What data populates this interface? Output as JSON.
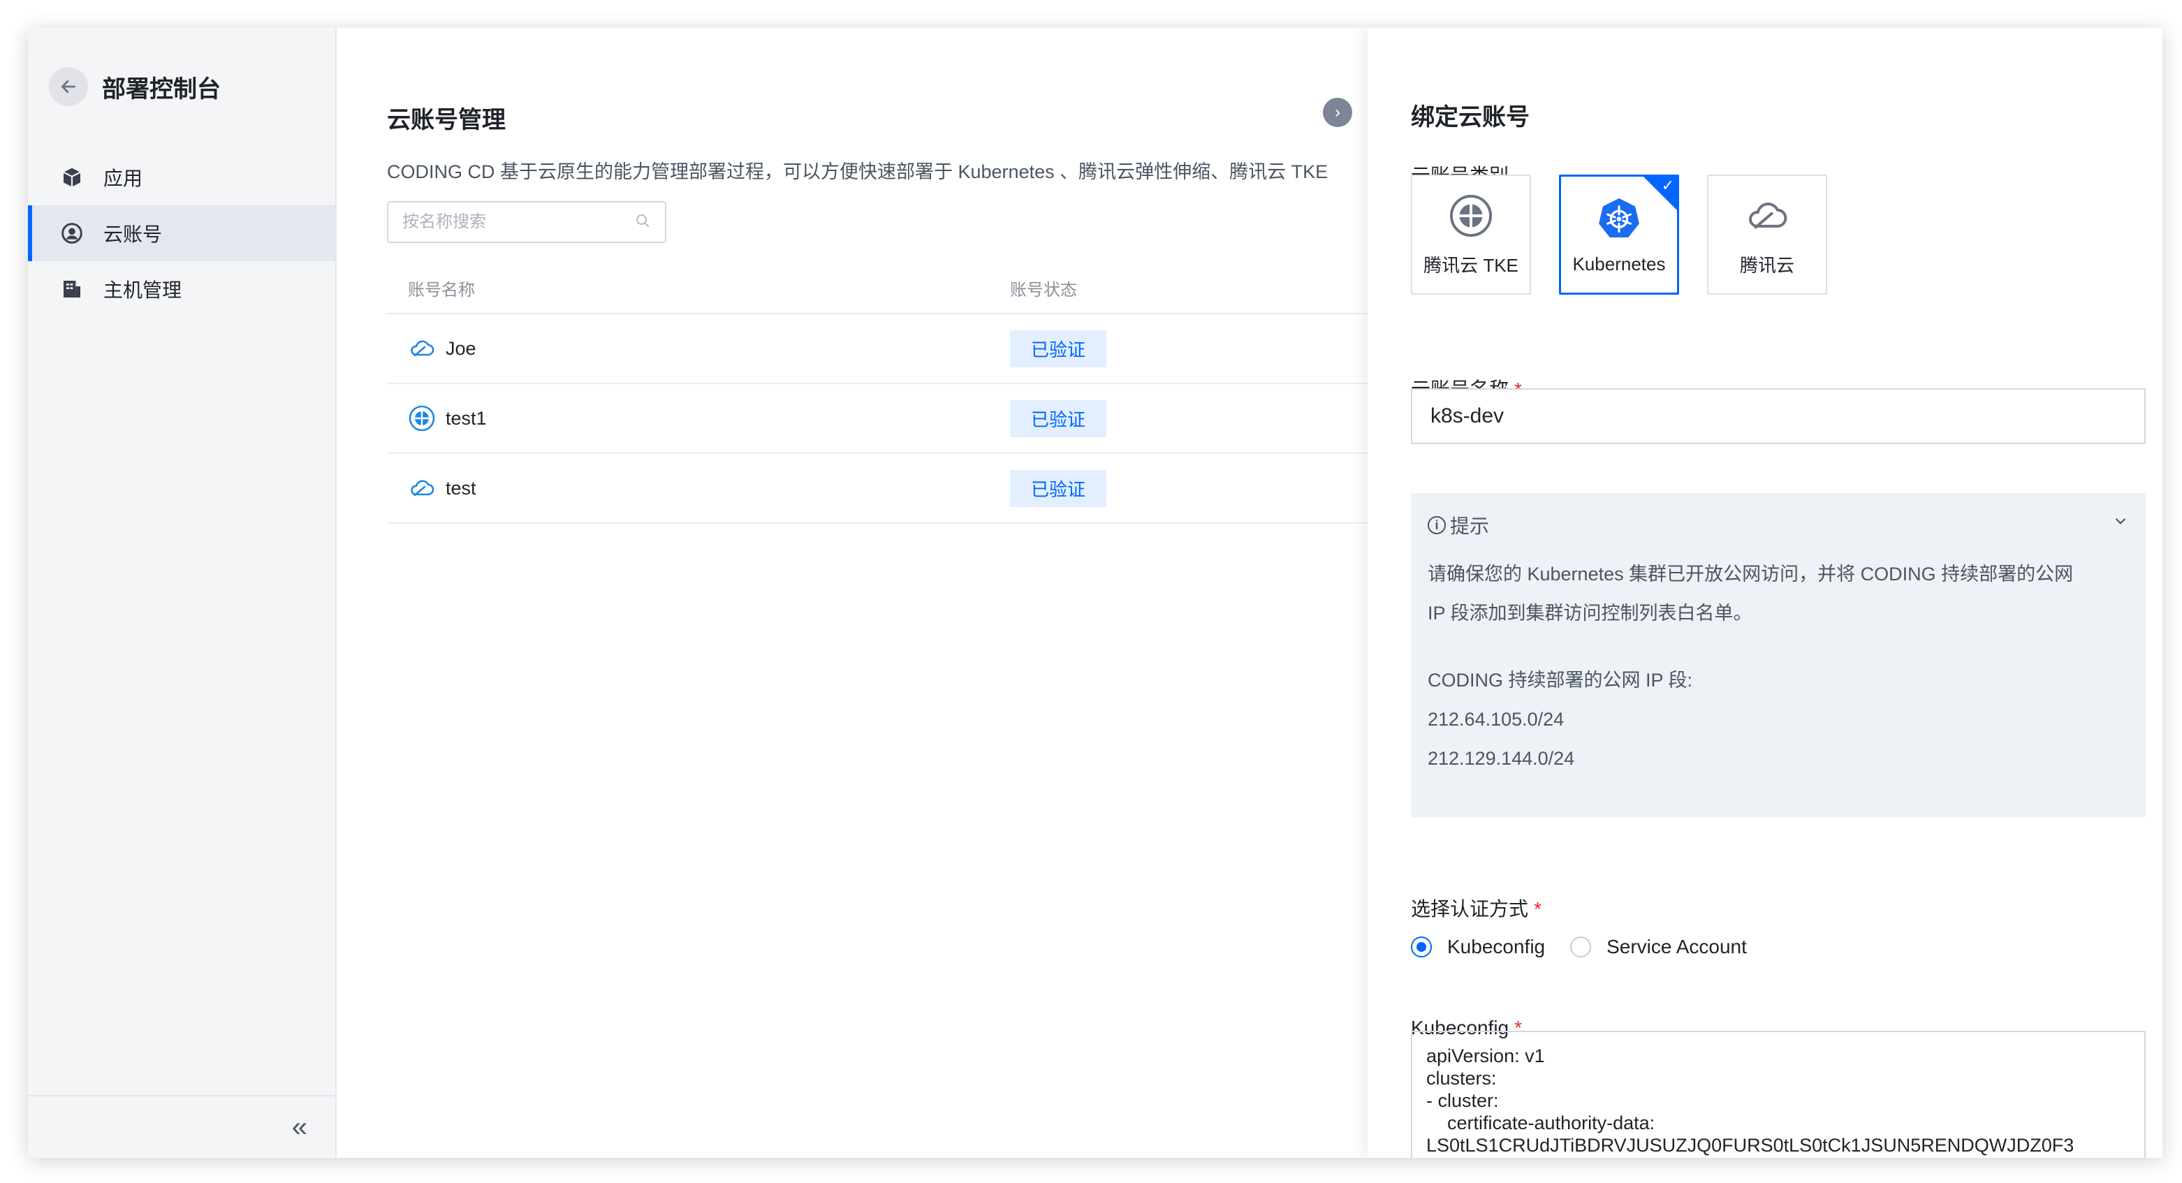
{
  "sidebar": {
    "title": "部署控制台",
    "items": [
      {
        "label": "应用",
        "icon": "cube-icon"
      },
      {
        "label": "云账号",
        "icon": "user-circle-icon"
      },
      {
        "label": "主机管理",
        "icon": "server-icon"
      }
    ],
    "active_item": "云账号",
    "collapse_icon": "double-chevron-left-icon"
  },
  "main": {
    "title": "云账号管理",
    "description": "CODING CD 基于云原生的能力管理部署过程，可以方便快速部署于 Kubernetes 、腾讯云弹性伸缩、腾讯云 TKE",
    "search": {
      "placeholder": "按名称搜索",
      "value": ""
    },
    "table": {
      "columns": [
        "账号名称",
        "账号状态"
      ],
      "rows": [
        {
          "name": "Joe",
          "icon": "cloud-icon",
          "status": "已验证"
        },
        {
          "name": "test1",
          "icon": "tke-icon",
          "status": "已验证"
        },
        {
          "name": "test",
          "icon": "cloud-icon",
          "status": "已验证"
        }
      ]
    }
  },
  "drawer": {
    "title": "绑定云账号",
    "type_label": "云账号类别",
    "types": [
      {
        "label": "腾讯云 TKE",
        "icon": "tke-icon",
        "selected": false
      },
      {
        "label": "Kubernetes",
        "icon": "kubernetes-icon",
        "selected": true
      },
      {
        "label": "腾讯云",
        "icon": "cloud-icon",
        "selected": false
      }
    ],
    "name_label": "云账号名称",
    "name_value": "k8s-dev",
    "required_mark": "*",
    "tip": {
      "title": "提示",
      "line1": "请确保您的 Kubernetes 集群已开放公网访问，并将 CODING 持续部署的公网",
      "line2": "IP 段添加到集群访问控制列表白名单。",
      "ip_title": "CODING 持续部署的公网 IP 段:",
      "ip1": "212.64.105.0/24",
      "ip2": "212.129.144.0/24"
    },
    "auth_label": "选择认证方式",
    "auth_options": [
      {
        "label": "Kubeconfig",
        "checked": true
      },
      {
        "label": "Service Account",
        "checked": false
      }
    ],
    "kubeconfig_label": "Kubeconfig",
    "kubeconfig_value": "apiVersion: v1\nclusters:\n- cluster:\n    certificate-authority-data:\nLS0tLS1CRUdJTiBDRVJUSUZJQ0FURS0tLS0tCk1JSUN5RENDQWJDZ0F3"
  },
  "colors": {
    "accent": "#0066ff",
    "required": "#f5222d",
    "badge_bg": "#e3efff",
    "sidebar_bg": "#f4f5f7",
    "tip_bg": "#eef1f6"
  }
}
